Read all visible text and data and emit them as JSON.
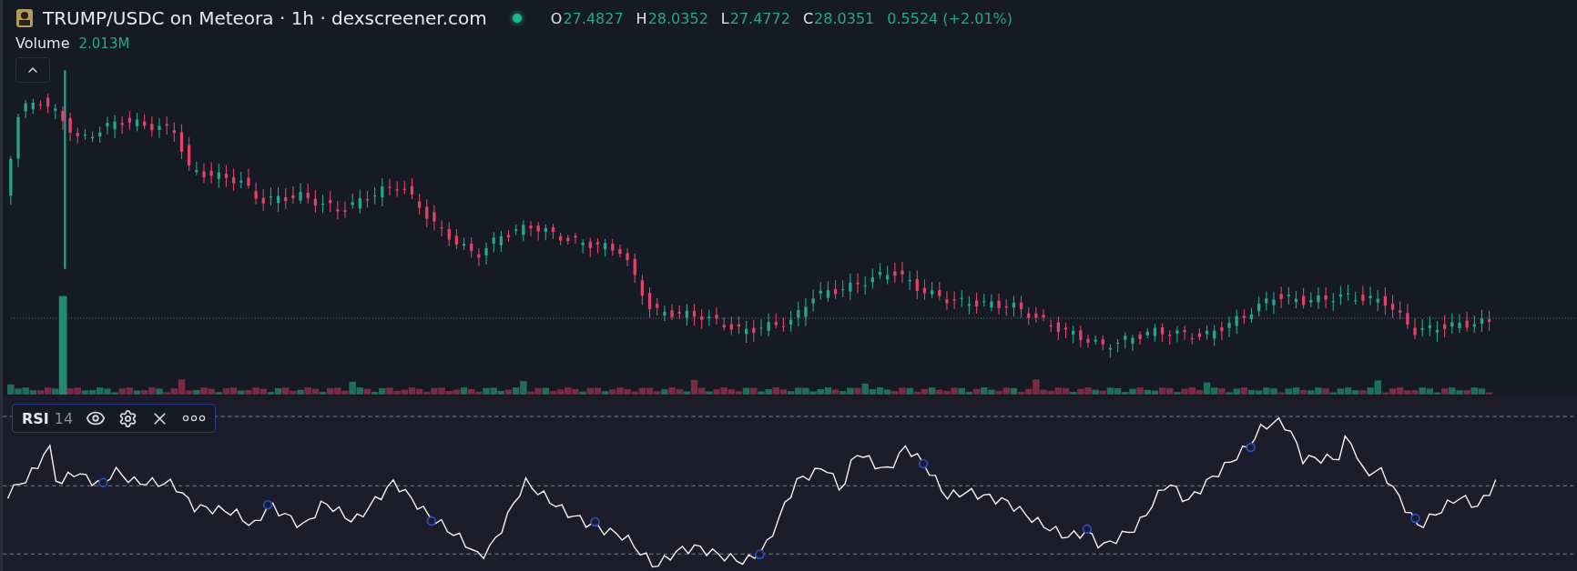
{
  "header": {
    "title": "TRUMP/USDC on Meteora · 1h · dexscreener.com",
    "ohlc": [
      {
        "label": "O",
        "value": "27.4827"
      },
      {
        "label": "H",
        "value": "28.0352"
      },
      {
        "label": "L",
        "value": "27.4772"
      },
      {
        "label": "C",
        "value": "28.0351"
      }
    ],
    "change": "0.5524 (+2.01%)"
  },
  "volume": {
    "label": "Volume",
    "value": "2.013M"
  },
  "rsi": {
    "name": "RSI",
    "length": "14"
  }
}
